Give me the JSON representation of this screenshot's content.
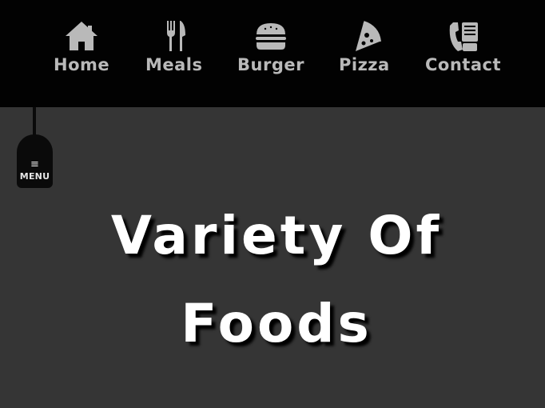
{
  "nav": {
    "items": [
      {
        "label": "Home",
        "icon": "home-icon"
      },
      {
        "label": "Meals",
        "icon": "fork-knife-icon"
      },
      {
        "label": "Burger",
        "icon": "burger-icon"
      },
      {
        "label": "Pizza",
        "icon": "pizza-icon"
      },
      {
        "label": "Contact",
        "icon": "phone-icon"
      }
    ]
  },
  "menu_toggle": {
    "icon_glyph": "≡",
    "label": "MENU"
  },
  "hero": {
    "title": "Variety Of Foods"
  },
  "colors": {
    "nav_bg": "#020202",
    "page_bg": "#353535",
    "nav_text": "#b9b9b9",
    "hero_text": "#ffffff"
  }
}
